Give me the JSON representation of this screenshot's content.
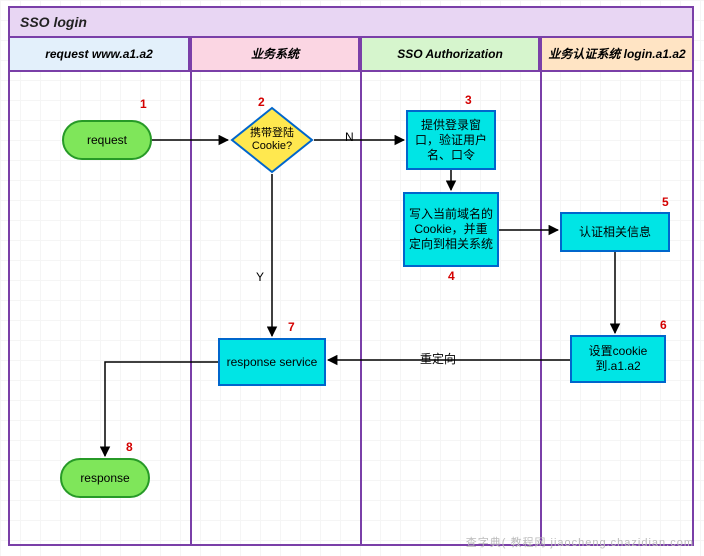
{
  "title": "SSO login",
  "lanes": {
    "lane1": "request www.a1.a2",
    "lane2": "业务系统",
    "lane3": "SSO Authorization",
    "lane4": "业务认证系统 login.a1.a2"
  },
  "nodes": {
    "n1": {
      "num": "1",
      "text": "request"
    },
    "n2": {
      "num": "2",
      "text": "携带登陆Cookie?"
    },
    "n3": {
      "num": "3",
      "text": "提供登录窗口，验证用户名、口令"
    },
    "n4": {
      "num": "4",
      "text": "写入当前域名的Cookie，并重定向到相关系统"
    },
    "n5": {
      "num": "5",
      "text": "认证相关信息"
    },
    "n6": {
      "num": "6",
      "text": "设置cookie 到.a1.a2"
    },
    "n7": {
      "num": "7",
      "text": "response service"
    },
    "n8": {
      "num": "8",
      "text": "response"
    }
  },
  "edges": {
    "e2_3": "N",
    "e2_7": "Y",
    "e6_7": "重定向"
  },
  "watermark": "查字典( 教程网 jiaocheng.chazidian.com"
}
